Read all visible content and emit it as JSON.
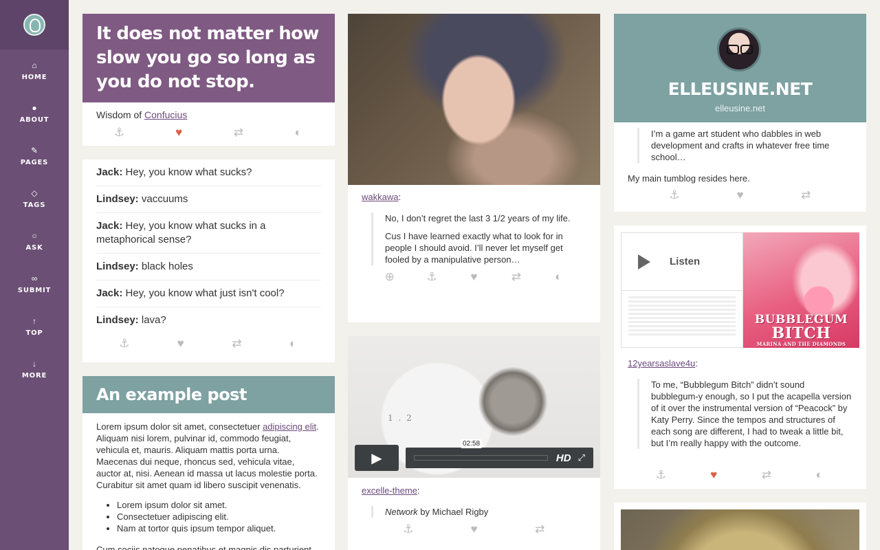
{
  "sidebar": {
    "items": [
      {
        "label": "HOME",
        "icon": "home-icon",
        "glyph": "⌂"
      },
      {
        "label": "ABOUT",
        "icon": "user-icon",
        "glyph": "●"
      },
      {
        "label": "PAGES",
        "icon": "pen-icon",
        "glyph": "✎"
      },
      {
        "label": "TAGS",
        "icon": "tag-icon",
        "glyph": "◇"
      },
      {
        "label": "ASK",
        "icon": "lightbulb-icon",
        "glyph": "○"
      },
      {
        "label": "SUBMIT",
        "icon": "link-icon",
        "glyph": "∞"
      },
      {
        "label": "TOP",
        "icon": "arrow-up-icon",
        "glyph": "↑"
      },
      {
        "label": "MORE",
        "icon": "arrow-down-icon",
        "glyph": "↓"
      }
    ]
  },
  "quote_post": {
    "text": "It does not matter how slow you go so long as you do not stop.",
    "source_prefix": "Wisdom of ",
    "source_link": "Confucius",
    "liked": true
  },
  "chat_post": {
    "lines": [
      {
        "speaker": "Jack:",
        "text": " Hey, you know what sucks?"
      },
      {
        "speaker": "Lindsey:",
        "text": " vaccuums"
      },
      {
        "speaker": "Jack:",
        "text": " Hey, you know what sucks in a metaphorical sense?"
      },
      {
        "speaker": "Lindsey:",
        "text": " black holes"
      },
      {
        "speaker": "Jack:",
        "text": " Hey, you know what just isn't cool?"
      },
      {
        "speaker": "Lindsey:",
        "text": " lava?"
      }
    ]
  },
  "text_post": {
    "title": "An example post",
    "p1_a": "Lorem ipsum dolor sit amet, consectetuer ",
    "p1_link": "adipiscing elit",
    "p1_b": ". Aliquam nisi lorem, pulvinar id, commodo feugiat, vehicula et, mauris. Aliquam mattis porta urna. Maecenas dui neque, rhoncus sed, vehicula vitae, auctor at, nisi. Aenean id massa ut lacus molestie porta. Curabitur sit amet quam id libero suscipit venenatis.",
    "list": [
      "Lorem ipsum dolor sit amet.",
      "Consectetuer adipiscing elit.",
      "Nam at tortor quis ipsum tempor aliquet."
    ],
    "p2": "Cum sociis natoque penatibus et magnis dis parturient"
  },
  "photo_post": {
    "source": "wakkawa",
    "quote_p1": "No, I don’t regret the last 3 1/2 years of my life.",
    "quote_p2": "Cus I have learned exactly what to look for in people I should avoid.  I’ll never let myself get fooled by a manipulative person…"
  },
  "video_post": {
    "timecode": "02:58",
    "hd_label": "HD",
    "source": "excelle-theme",
    "caption_title": "Network",
    "caption_by": " by Michael Rigby",
    "overlay_text": "1 . 2"
  },
  "profile": {
    "title": "ELLEUSINE.NET",
    "url": "elleusine.net",
    "bio": "I’m a game art student who dabbles in web development and crafts in whatever free time school…",
    "note": "My main tumblog resides here."
  },
  "audio_post": {
    "listen_label": "Listen",
    "album_title_1": "BUBBLEGUM",
    "album_title_2": "BITCH",
    "album_artist": "MARINA AND THE DIAMONDS",
    "source": "12yearsaslave4u",
    "quote": "To me, “Bubblegum Bitch” didn’t sound bubblegum-y enough, so I put the acapella version of it over the instrumental version of “Peacock” by Katy Perry. Since the tempos and structures of each song are different, I had to tweak a little bit, but I’m really happy with the outcome.",
    "liked": true
  },
  "colors": {
    "sidebar": "#6b4f75",
    "quote_header": "#7f5a83",
    "teal_header": "#7ea1a2",
    "like_active": "#d9604a",
    "background": "#f2f1ec"
  }
}
